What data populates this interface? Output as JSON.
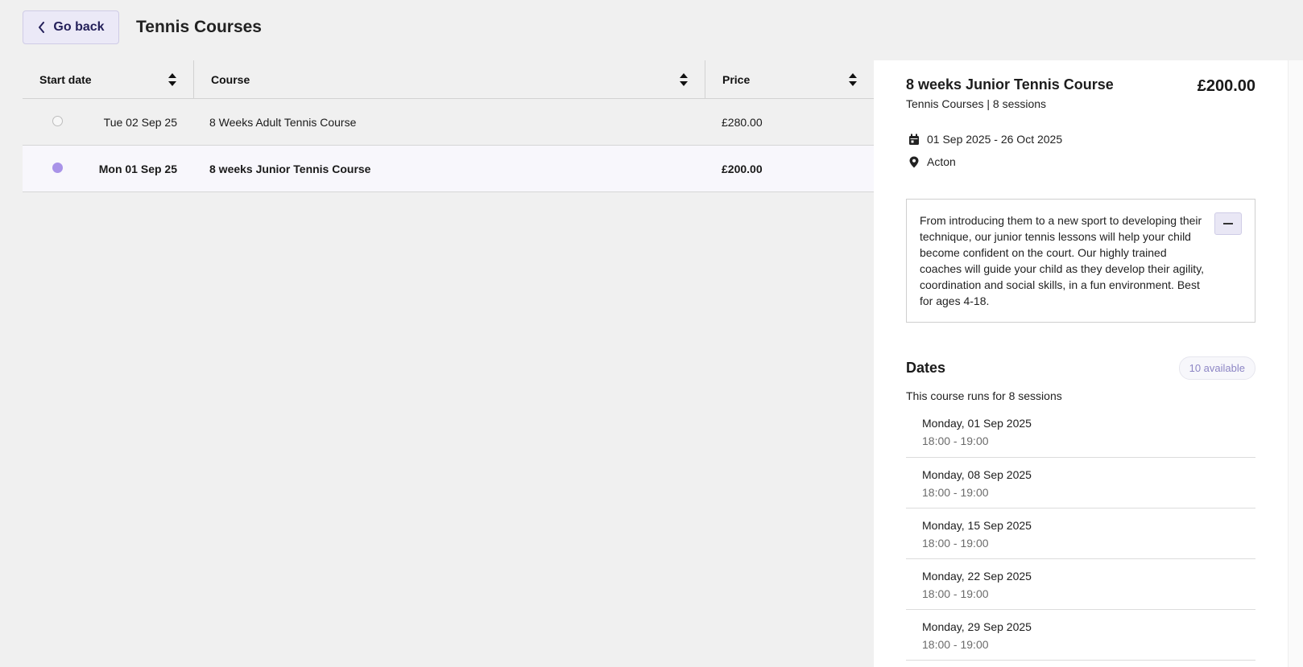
{
  "header": {
    "back_label": "Go back",
    "title": "Tennis Courses"
  },
  "table": {
    "columns": [
      "Start date",
      "Course",
      "Price"
    ],
    "rows": [
      {
        "date": "Tue 02 Sep 25",
        "course": "8 Weeks Adult Tennis Course",
        "price": "£280.00",
        "selected": false
      },
      {
        "date": "Mon 01 Sep 25",
        "course": "8 weeks Junior Tennis Course",
        "price": "£200.00",
        "selected": true
      }
    ]
  },
  "detail": {
    "title": "8 weeks Junior Tennis Course",
    "subtitle": "Tennis Courses | 8 sessions",
    "price": "£200.00",
    "date_range": "01 Sep 2025 - 26 Oct 2025",
    "location": "Acton",
    "description": "From introducing them to a new sport to developing their technique, our junior tennis lessons will help your child become confident on the court. Our highly trained coaches will guide your child as they develop their agility, coordination and social skills, in a fun environment. Best for ages 4-18.",
    "dates_heading": "Dates",
    "availability": "10 available",
    "runs_text": "This course runs for 8 sessions",
    "sessions": [
      {
        "date": "Monday, 01 Sep 2025",
        "time": "18:00 - 19:00"
      },
      {
        "date": "Monday, 08 Sep 2025",
        "time": "18:00 - 19:00"
      },
      {
        "date": "Monday, 15 Sep 2025",
        "time": "18:00 - 19:00"
      },
      {
        "date": "Monday, 22 Sep 2025",
        "time": "18:00 - 19:00"
      },
      {
        "date": "Monday, 29 Sep 2025",
        "time": "18:00 - 19:00"
      }
    ]
  },
  "colors": {
    "accent": "#a993e8",
    "back_button_bg": "#ebe9f7",
    "badge_text": "#8d86c5"
  },
  "icons": [
    "chevron-left-icon",
    "sort-icon",
    "calendar-icon",
    "location-pin-icon",
    "minus-icon"
  ]
}
